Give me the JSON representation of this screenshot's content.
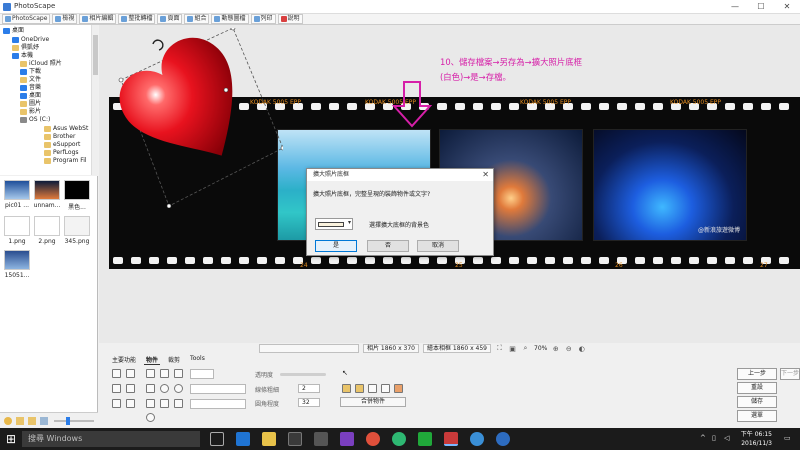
{
  "window": {
    "title": "PhotoScape",
    "minimize": "—",
    "maximize": "☐",
    "close": "✕"
  },
  "menu": [
    {
      "label": "PhotoScape"
    },
    {
      "label": "檢視"
    },
    {
      "label": "相片編輯"
    },
    {
      "label": "整批轉檔"
    },
    {
      "label": "頁面"
    },
    {
      "label": "組合"
    },
    {
      "label": "動態圖檔"
    },
    {
      "label": "列印"
    },
    {
      "label": "說明"
    }
  ],
  "tree": {
    "items": [
      {
        "label": "桌面"
      },
      {
        "label": "OneDrive"
      },
      {
        "label": "俱凱妤"
      },
      {
        "label": "本機"
      },
      {
        "label": "iCloud 照片"
      },
      {
        "label": "下載"
      },
      {
        "label": "文件"
      },
      {
        "label": "音樂"
      },
      {
        "label": "桌面"
      },
      {
        "label": "圖片"
      },
      {
        "label": "影片"
      },
      {
        "label": "OS (C:)"
      },
      {
        "label": "Asus WebSt"
      },
      {
        "label": "Brother"
      },
      {
        "label": "eSupport"
      },
      {
        "label": "PerfLogs"
      },
      {
        "label": "Program Fil"
      }
    ]
  },
  "thumbnails": [
    {
      "label": "pic01 ..."
    },
    {
      "label": "unnam..."
    },
    {
      "label": "黑色..."
    },
    {
      "label": "1.png"
    },
    {
      "label": "2.png"
    },
    {
      "label": "345.png"
    },
    {
      "label": "15051..."
    }
  ],
  "canvas": {
    "annotation_line1": "10、儲存檔案→另存為→擴大照片底框",
    "annotation_line2": "(白色)→是→存檔。",
    "film_label": "KODAK 5005 EPP",
    "film_frame_numbers": [
      "24",
      "25",
      "26",
      "27"
    ],
    "photo3_caption": "@新浪旅遊微博"
  },
  "dialog": {
    "title": "擴大照片底框",
    "close": "✕",
    "prompt": "擴大照片底框，完整呈現的裝飾物件或文字?",
    "color_label": "選擇擴大底框的背景色",
    "color_value": "#FBF3DE",
    "yes": "是",
    "no": "否",
    "cancel": "取消"
  },
  "status": {
    "photo_size": "相片 1860 x 370",
    "canvas_size": "繪本相框 1860 x 459",
    "zoom": "70%"
  },
  "tools": {
    "tabs": [
      "主要功能",
      "物件",
      "裁剪",
      "Tools"
    ],
    "active_tab": "物件",
    "opacity_label": "透明度",
    "border_label": "線條粗細",
    "round_label": "圓角程度",
    "border_value": "2",
    "round_value": "32",
    "merge_button": "合併物件"
  },
  "right_buttons": {
    "prev": "上一步",
    "next": "下一步",
    "reset": "重設",
    "save": "儲存",
    "menu": "選單"
  },
  "taskbar": {
    "search_placeholder": "搜尋 Windows",
    "time": "下午 06:15",
    "date": "2016/11/3"
  },
  "colors": {
    "accent_pink": "#D61FA8",
    "film_orange": "#E08A1E",
    "heart_red": "#E8121E"
  }
}
